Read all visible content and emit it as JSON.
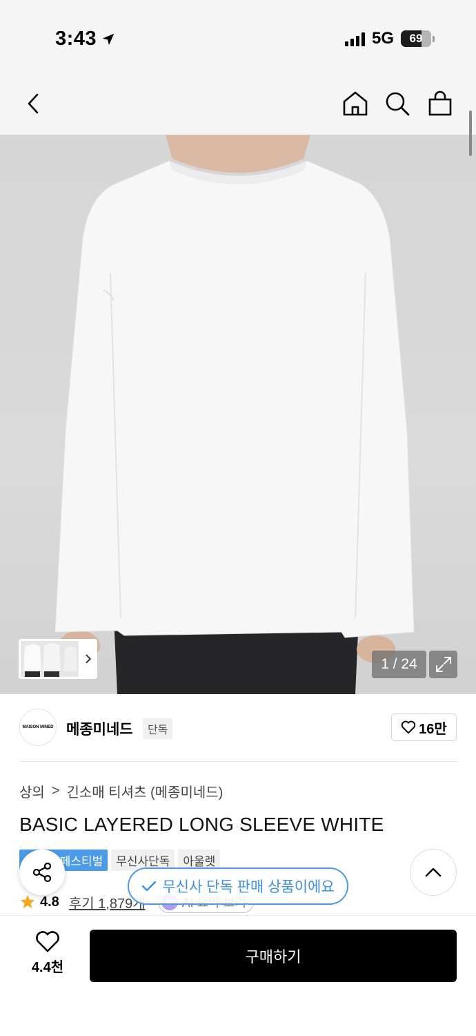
{
  "status_bar": {
    "time": "3:43",
    "network": "5G",
    "battery": "69"
  },
  "header": {
    "back_icon": "chevron-left-icon",
    "home_icon": "home-icon",
    "search_icon": "search-icon",
    "cart_icon": "shopping-bag-icon"
  },
  "gallery": {
    "counter": "1 / 24"
  },
  "brand": {
    "logo_text": "MAISON MINED",
    "name": "메종미네드",
    "tag": "단독",
    "likes": "16만"
  },
  "breadcrumb": {
    "category": "상의",
    "separator": ">",
    "subcategory": "긴소매 티셔츠 (메종미네드)"
  },
  "product": {
    "title": "BASIC LAYERED LONG SLEEVE WHITE",
    "tags": [
      "무신사 페스티벌",
      "무신사단독",
      "아울렛"
    ],
    "rating": "4.8",
    "reviews": "후기 1,879개",
    "ai_label": "AI",
    "ai_summary": "AI 요약 보기"
  },
  "toast": {
    "text": "무신사 단독 판매 상품이에요"
  },
  "bottom_bar": {
    "wish_count": "4.4천",
    "buy_label": "구매하기"
  },
  "colors": {
    "accent_blue": "#4b9be8",
    "star": "#f5a623",
    "buy_bg": "#000000"
  }
}
